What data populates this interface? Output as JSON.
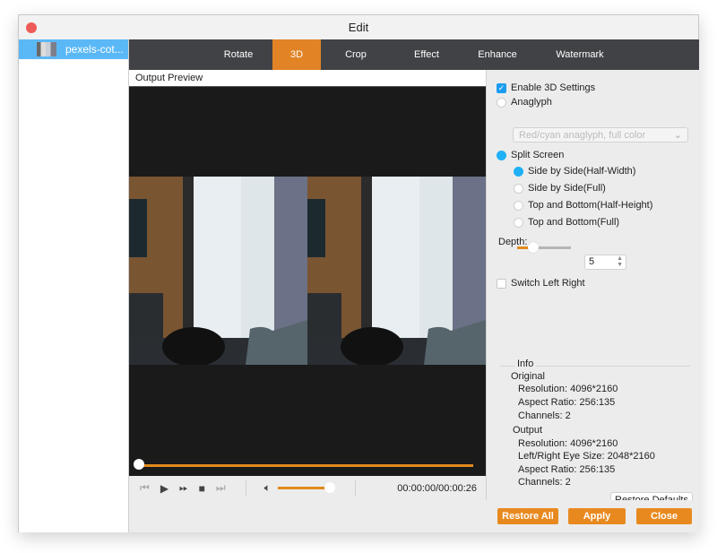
{
  "window": {
    "title": "Edit"
  },
  "sidebar": {
    "items": [
      {
        "label": "pexels-cot...",
        "selected": true
      }
    ]
  },
  "tabs": [
    {
      "label": "Rotate",
      "active": false
    },
    {
      "label": "3D",
      "active": true
    },
    {
      "label": "Crop",
      "active": false
    },
    {
      "label": "Effect",
      "active": false
    },
    {
      "label": "Enhance",
      "active": false
    },
    {
      "label": "Watermark",
      "active": false
    }
  ],
  "preview": {
    "label": "Output Preview",
    "progress_fraction": 0.0,
    "volume_fraction": 1.0,
    "timecode": "00:00:00/00:00:26",
    "controls": [
      "skip-back-icon",
      "play-icon",
      "fast-forward-icon",
      "stop-icon",
      "skip-forward-icon",
      "volume-icon"
    ]
  },
  "settings": {
    "enable_3d": {
      "label": "Enable 3D Settings",
      "checked": true
    },
    "anaglyph": {
      "label": "Anaglyph",
      "selected": false,
      "dropdown_value": "Red/cyan anaglyph, full color"
    },
    "split_screen": {
      "label": "Split Screen",
      "selected": true
    },
    "split_options": [
      {
        "label": "Side by Side(Half-Width)",
        "selected": true
      },
      {
        "label": "Side by Side(Full)",
        "selected": false
      },
      {
        "label": "Top and Bottom(Half-Height)",
        "selected": false
      },
      {
        "label": "Top and Bottom(Full)",
        "selected": false
      }
    ],
    "depth": {
      "label": "Depth:",
      "value": "5",
      "slider_fraction": 0.3
    },
    "switch_left_right": {
      "label": "Switch Left Right",
      "checked": false
    }
  },
  "info": {
    "title": "Info",
    "original_label": "Original",
    "original": [
      "Resolution: 4096*2160",
      "Aspect Ratio: 256:135",
      "Channels: 2"
    ],
    "output_label": "Output",
    "output": [
      "Resolution: 4096*2160",
      "Left/Right Eye Size: 2048*2160",
      "Aspect Ratio: 256:135",
      "Channels: 2"
    ]
  },
  "buttons": {
    "restore_defaults": "Restore Defaults",
    "restore_all": "Restore All",
    "apply": "Apply",
    "close": "Close"
  },
  "colors": {
    "accent": "#e28326",
    "selection": "#5bb8f6",
    "radio": "#1fb0f5",
    "tabbar": "#414246"
  }
}
